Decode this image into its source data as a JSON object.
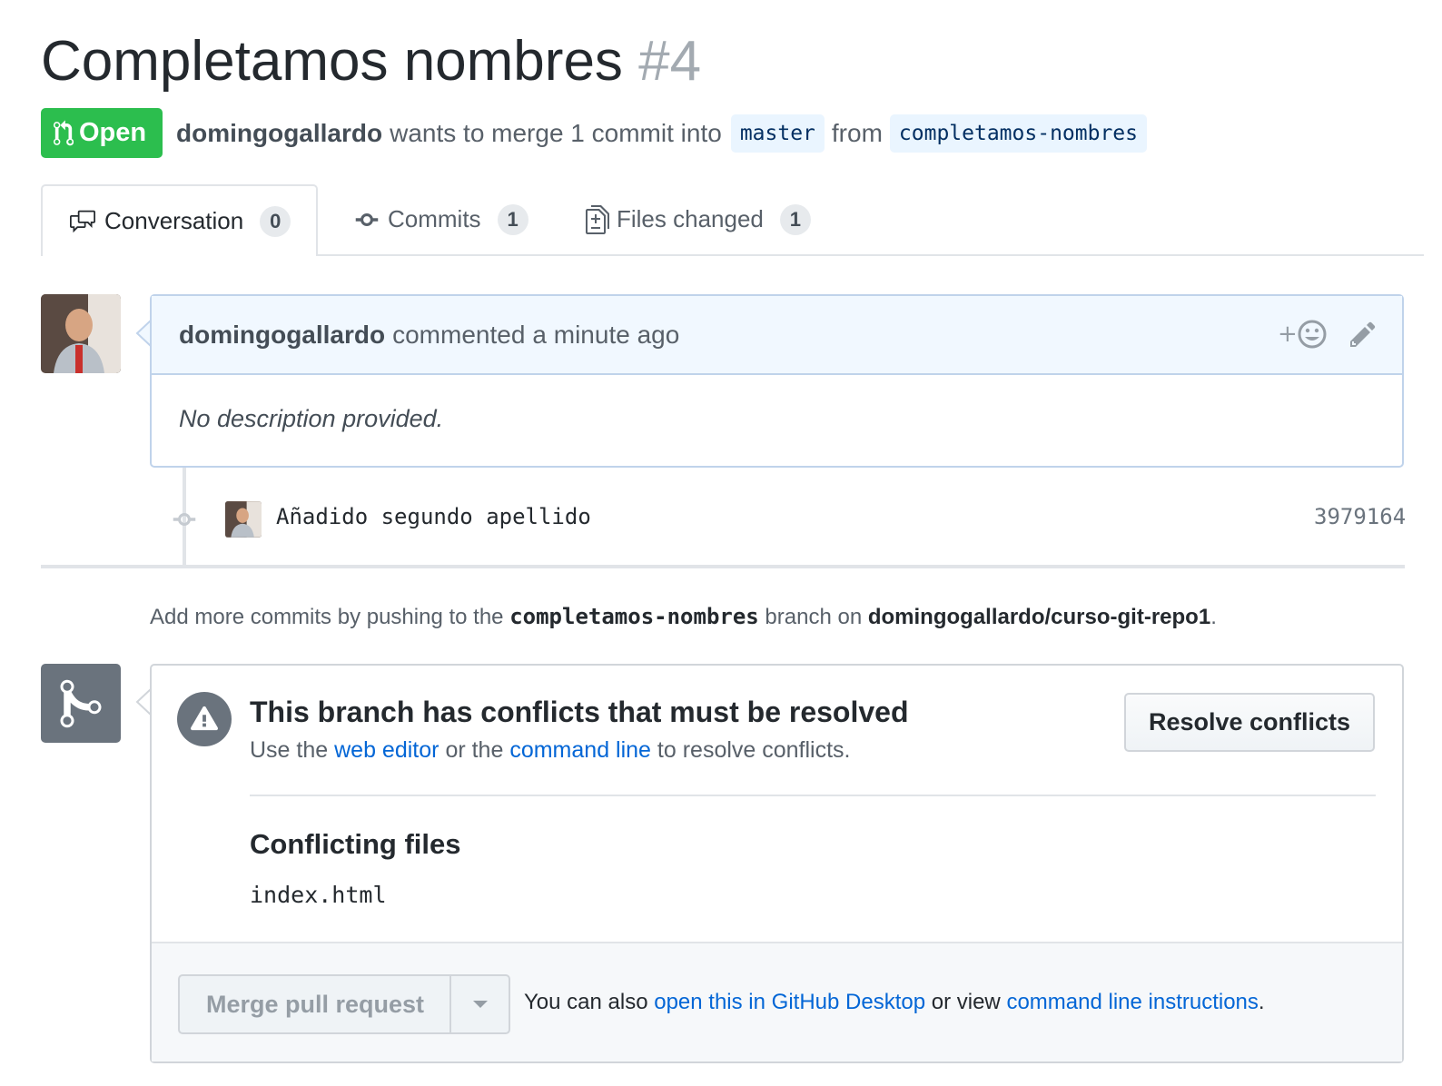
{
  "header": {
    "title": "Completamos nombres",
    "number": "#4",
    "state": "Open",
    "author": "domingogallardo",
    "merge_text": "wants to merge 1 commit into",
    "base_branch": "master",
    "from_text": "from",
    "head_branch": "completamos-nombres"
  },
  "tabs": [
    {
      "label": "Conversation",
      "count": "0",
      "icon": "comment-discussion-icon"
    },
    {
      "label": "Commits",
      "count": "1",
      "icon": "git-commit-icon"
    },
    {
      "label": "Files changed",
      "count": "1",
      "icon": "file-diff-icon"
    }
  ],
  "comment": {
    "author": "domingogallardo",
    "action": "commented",
    "time": "a minute ago",
    "body": "No description provided.",
    "reaction_icon": "add-reaction-icon",
    "edit_icon": "pencil-icon"
  },
  "commit": {
    "message": "Añadido segundo apellido",
    "sha": "3979164"
  },
  "push_note": {
    "prefix": "Add more commits by pushing to the",
    "branch": "completamos-nombres",
    "middle": "branch on",
    "repo": "domingogallardo/curso-git-repo1",
    "suffix": "."
  },
  "merge": {
    "conflict_title": "This branch has conflicts that must be resolved",
    "desc_prefix": "Use the",
    "web_editor_link": "web editor",
    "desc_or": "or the",
    "command_line_link": "command line",
    "desc_suffix": "to resolve conflicts.",
    "resolve_button": "Resolve conflicts",
    "files_title": "Conflicting files",
    "files": [
      "index.html"
    ],
    "merge_button": "Merge pull request",
    "alt_prefix": "You can also",
    "desktop_link": "open this in GitHub Desktop",
    "alt_or": "or view",
    "cli_link": "command line instructions",
    "alt_suffix": "."
  },
  "colors": {
    "open_green": "#2cbe4e",
    "link_blue": "#0366d6",
    "comment_header_bg": "#f1f8ff",
    "icon_gray": "#6a737d"
  }
}
